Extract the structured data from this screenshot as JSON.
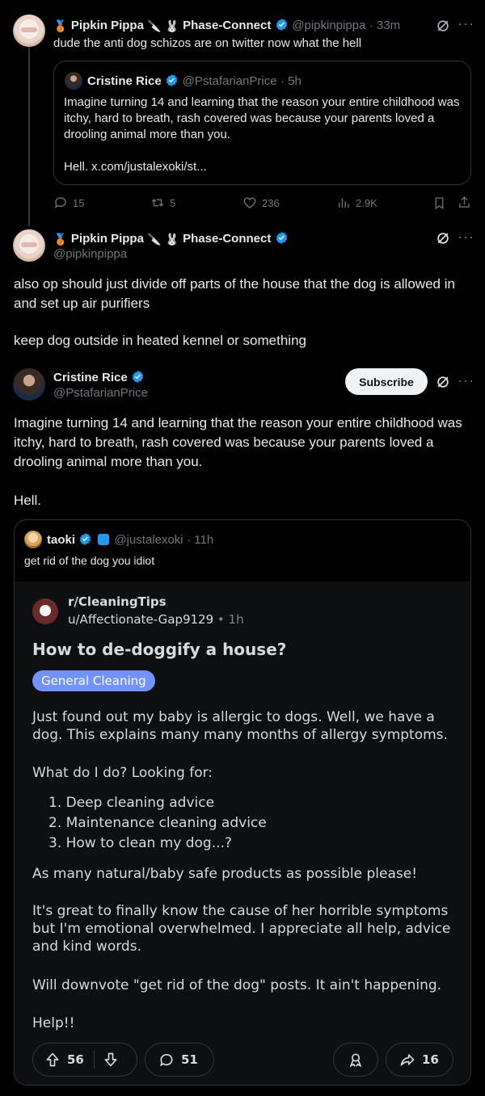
{
  "tweet1": {
    "author_name": "Pipkin Pippa",
    "author_suffix": "Phase-Connect",
    "handle": "@pipkinpippa",
    "time": "· 33m",
    "text": "dude the anti dog schizos are on twitter now what the hell",
    "quote": {
      "author_name": "Cristine Rice",
      "handle": "@PstafarianPrice",
      "time": "· 5h",
      "text": "Imagine turning 14 and learning that the reason your entire childhood was itchy, hard to breath, rash covered was because your parents loved a drooling animal more than you.",
      "link": "Hell. x.com/justalexoki/st..."
    },
    "stats": {
      "replies": "15",
      "reposts": "5",
      "likes": "236",
      "views": "2.9K"
    }
  },
  "tweet2": {
    "author_name": "Pipkin Pippa",
    "author_suffix": "Phase-Connect",
    "handle": "@pipkinpippa",
    "text1": "also op should just divide off parts of the house that the dog is allowed in and set up air purifiers",
    "text2": "keep dog outside in heated kennel or something"
  },
  "tweet3": {
    "author_name": "Cristine Rice",
    "handle": "@PstafarianPrice",
    "subscribe_label": "Subscribe",
    "text": "Imagine turning 14 and learning that the reason your entire childhood was itchy, hard to breath, rash covered was because your parents loved a drooling animal more than you.",
    "text2": "Hell.",
    "quote": {
      "author_name": "taoki",
      "handle": "@justalexoki",
      "time": "· 11h",
      "text": "get rid of the dog you idiot"
    }
  },
  "reddit": {
    "subreddit": "r/CleaningTips",
    "user": "u/Affectionate-Gap9129",
    "time": "• 1h",
    "title": "How to de-doggify a house?",
    "flair": "General Cleaning",
    "p1": "Just found out my baby is allergic to dogs. Well, we have a dog. This explains many many months of allergy symptoms.",
    "p2": "What do I do? Looking for:",
    "list": [
      "1. Deep cleaning advice",
      "2. Maintenance cleaning advice",
      "3. How to clean my dog...?"
    ],
    "p3": "As many natural/baby safe products as possible please!",
    "p4": "It's great to finally know the cause of her horrible symptoms but I'm emotional overwhelmed. I appreciate all help, advice and kind words.",
    "p5": "Will downvote \"get rid of the dog\" posts. It ain't happening.",
    "p6": "Help!!",
    "votes": "56",
    "comments": "51",
    "shares": "16"
  },
  "colors": {
    "accent": "#1d9bf0",
    "muted": "#71767b",
    "flair": "#7193ff"
  }
}
